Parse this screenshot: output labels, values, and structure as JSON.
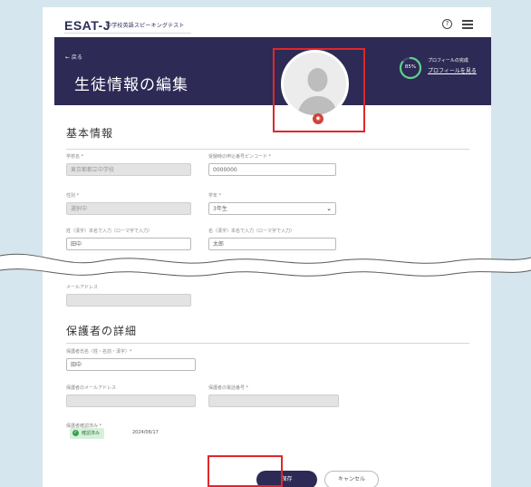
{
  "header": {
    "logo": "ESAT-J",
    "logo_subtitle": "中学校英語スピーキングテスト",
    "help_icon": "question-circle-icon",
    "menu_icon": "hamburger-menu-icon"
  },
  "hero": {
    "back_label": "← 戻る",
    "title": "生徒情報の編集",
    "progress_percent": 85,
    "progress_label": "85%",
    "profile_status": "プロフィールの完成",
    "profile_link": "プロフィールを見る"
  },
  "avatar": {
    "icon": "user-silhouette-icon",
    "camera_icon": "camera-icon"
  },
  "basic_info": {
    "heading": "基本情報",
    "school_label": "学校名 *",
    "school_value": "東京都都立中学校",
    "exam_number_label": "受験時の申込番号ピンコード *",
    "exam_number_value": "0000000",
    "pref_label": "性別 *",
    "pref_value": "選択中",
    "grade_label": "学年 *",
    "grade_value": "3年生",
    "last_name_label": "姓（漢字）本名で入力（ローマ字で入力）",
    "last_name_value": "田中",
    "first_name_label": "名（漢字）本名で入力（ローマ字で入力）",
    "first_name_value": "太郎",
    "email_label": "メールアドレス",
    "email_value": ""
  },
  "guardian": {
    "heading": "保護者の詳細",
    "name_label": "保護者氏名（姓・名前・漢字）*",
    "name_value": "田中",
    "email_label": "保護者のメールアドレス",
    "email_value": "",
    "phone_label": "保護者の電話番号 *",
    "phone_value": "",
    "verify_label": "保護者確認済み *",
    "verify_badge": "確認済み",
    "verify_date": "2024/06/17"
  },
  "actions": {
    "save_label": "保存",
    "cancel_label": "キャンセル"
  },
  "colors": {
    "navy": "#2d2a55",
    "highlight_red": "#e1262b",
    "background": "#d5e6ee",
    "success_green": "#3aa050"
  }
}
